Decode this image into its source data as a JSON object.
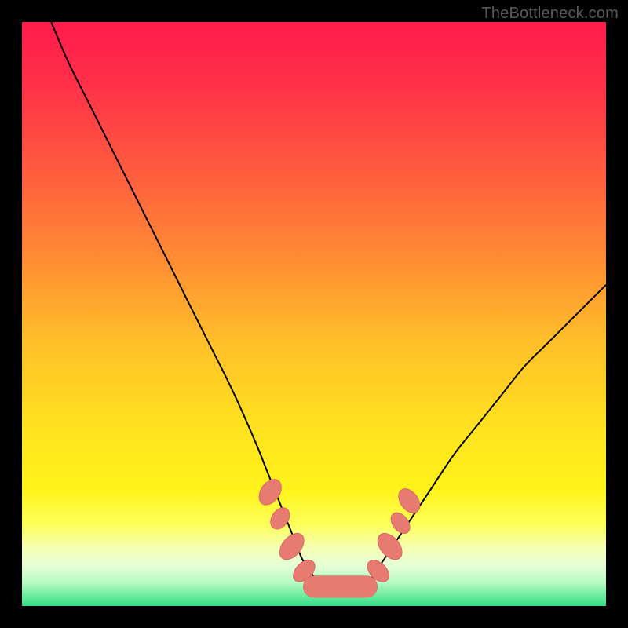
{
  "watermark": {
    "text": "TheBottleneck.com"
  },
  "colors": {
    "black": "#000000",
    "gradient_stops": [
      {
        "offset": 0.0,
        "color": "#ff1b4b"
      },
      {
        "offset": 0.1,
        "color": "#ff2f49"
      },
      {
        "offset": 0.25,
        "color": "#ff5a3f"
      },
      {
        "offset": 0.4,
        "color": "#ff8a34"
      },
      {
        "offset": 0.55,
        "color": "#ffc029"
      },
      {
        "offset": 0.7,
        "color": "#ffe31f"
      },
      {
        "offset": 0.8,
        "color": "#fff31a"
      },
      {
        "offset": 0.86,
        "color": "#fdff59"
      },
      {
        "offset": 0.9,
        "color": "#f6ffb3"
      },
      {
        "offset": 0.93,
        "color": "#e6ffd6"
      },
      {
        "offset": 0.96,
        "color": "#b7fbc3"
      },
      {
        "offset": 0.985,
        "color": "#63e99a"
      },
      {
        "offset": 1.0,
        "color": "#36da85"
      }
    ],
    "curve": "#000000",
    "marker_fill": "#e77a71",
    "marker_stroke": "#d66a63"
  },
  "chart_data": {
    "type": "line",
    "title": "",
    "xlabel": "",
    "ylabel": "",
    "xlim": [
      0,
      100
    ],
    "ylim": [
      0,
      100
    ],
    "series": [
      {
        "name": "bottleneck-curve",
        "x": [
          5,
          8,
          12,
          16,
          20,
          24,
          28,
          32,
          36,
          40,
          42,
          44,
          46,
          48,
          50,
          52,
          54,
          56,
          58,
          60,
          62,
          66,
          70,
          74,
          78,
          82,
          86,
          90,
          94,
          98,
          100
        ],
        "y": [
          100,
          93,
          85,
          77,
          69,
          61,
          53,
          45,
          37,
          28,
          23,
          18,
          13,
          8,
          5,
          3,
          2,
          2,
          3,
          5,
          8,
          14,
          20,
          26,
          31,
          36,
          41,
          45,
          49,
          53,
          55
        ]
      }
    ],
    "markers": [
      {
        "shape": "ellipse",
        "x": 42.5,
        "y": 19.5,
        "rx": 1.6,
        "ry": 2.4,
        "rot": 35
      },
      {
        "shape": "ellipse",
        "x": 44.2,
        "y": 15.0,
        "rx": 1.4,
        "ry": 2.0,
        "rot": 35
      },
      {
        "shape": "ellipse",
        "x": 46.2,
        "y": 10.2,
        "rx": 1.6,
        "ry": 2.6,
        "rot": 40
      },
      {
        "shape": "ellipse",
        "x": 48.3,
        "y": 6.0,
        "rx": 1.4,
        "ry": 2.2,
        "rot": 45
      },
      {
        "shape": "capsule",
        "x1": 50.0,
        "y1": 3.3,
        "x2": 59.0,
        "y2": 3.3,
        "r": 1.8
      },
      {
        "shape": "ellipse",
        "x": 61.0,
        "y": 6.0,
        "rx": 1.4,
        "ry": 2.2,
        "rot": -45
      },
      {
        "shape": "ellipse",
        "x": 63.0,
        "y": 10.2,
        "rx": 1.6,
        "ry": 2.6,
        "rot": -40
      },
      {
        "shape": "ellipse",
        "x": 64.8,
        "y": 14.2,
        "rx": 1.3,
        "ry": 2.0,
        "rot": -38
      },
      {
        "shape": "ellipse",
        "x": 66.3,
        "y": 18.0,
        "rx": 1.5,
        "ry": 2.3,
        "rot": -35
      }
    ]
  }
}
